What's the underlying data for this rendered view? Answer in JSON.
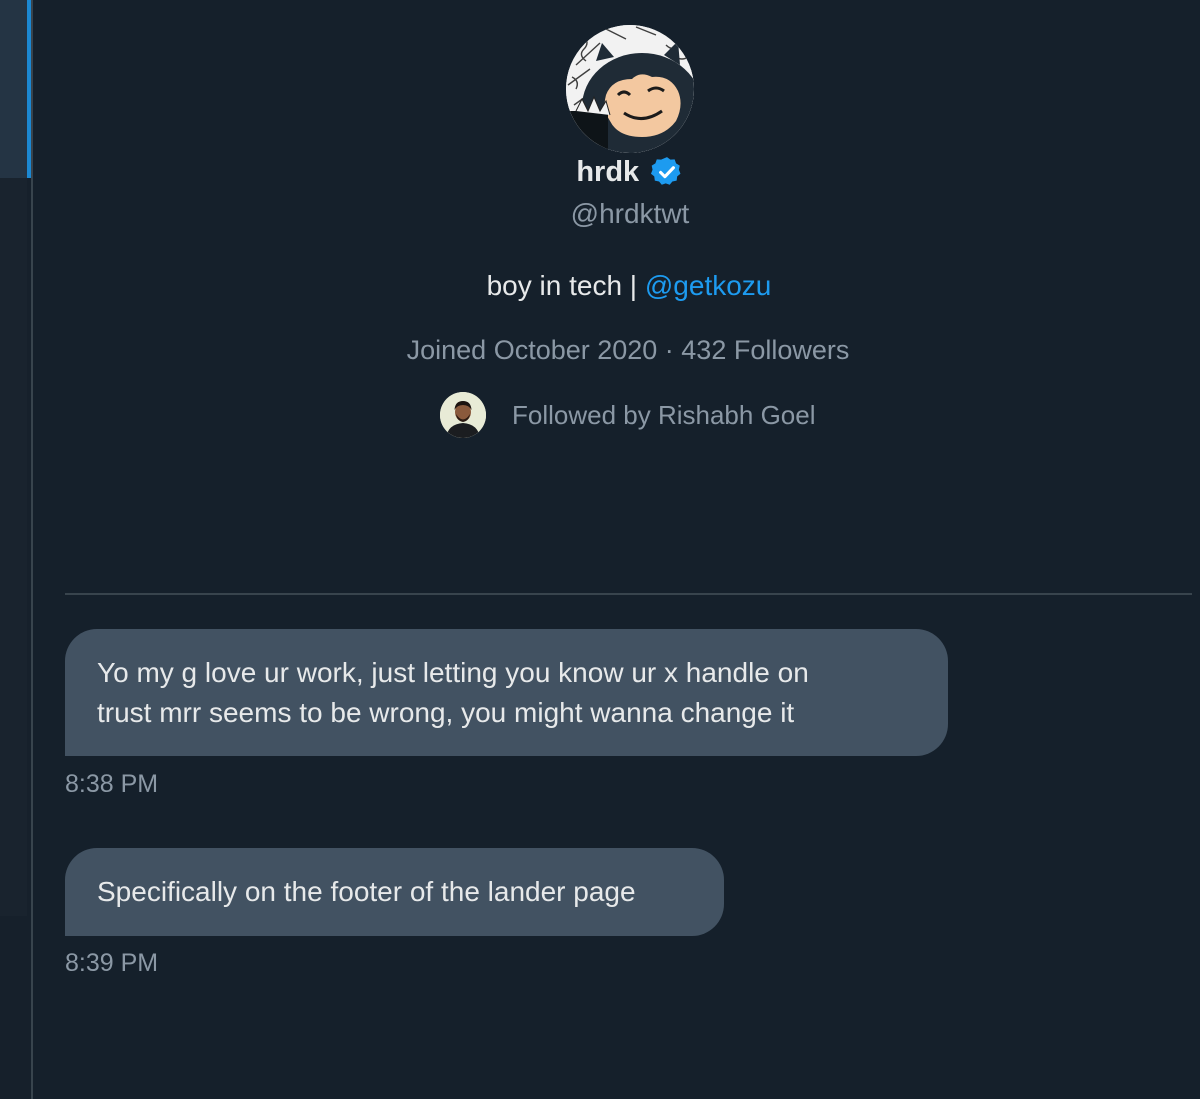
{
  "profile": {
    "avatar_icon": "snorlax-avatar-icon",
    "display_name": "hrdk",
    "verified_icon": "verified-badge-icon",
    "handle": "@hrdktwt",
    "bio_text": "boy in tech | ",
    "bio_link": "@getkozu",
    "meta": "Joined October 2020 · 432 Followers",
    "followed_by": "Followed by Rishabh Goel"
  },
  "messages": [
    {
      "lines": [
        "Yo my g love ur work, just letting you know ur x handle on",
        "trust mrr seems to be wrong, you might wanna change it"
      ],
      "time": "8:38 PM"
    },
    {
      "lines": [
        "Specifically on the footer of the lander page"
      ],
      "time": "8:39 PM"
    }
  ],
  "colors": {
    "background": "#15202b",
    "bubble": "#425262",
    "accent": "#1d9bf0",
    "text_primary": "#e7e9ea",
    "text_secondary": "#8b98a5",
    "divider": "#38444d"
  }
}
